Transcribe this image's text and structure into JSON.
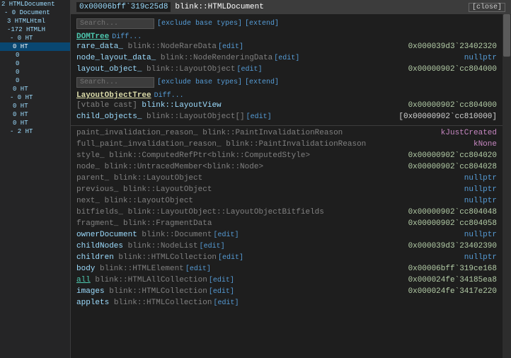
{
  "leftPanel": {
    "items": [
      {
        "label": "2 HTMLDocument",
        "indent": 0,
        "selected": false
      },
      {
        "label": "  - 0 Document",
        "indent": 1,
        "selected": false
      },
      {
        "label": "    3 HTMLHtml",
        "indent": 2,
        "selected": false
      },
      {
        "label": "  -172 HTMLH",
        "indent": 2,
        "selected": false
      },
      {
        "label": "      - 0 HT",
        "indent": 3,
        "selected": false
      },
      {
        "label": "        0 HT",
        "indent": 4,
        "selected": true
      },
      {
        "label": "          0",
        "indent": 5,
        "selected": false
      },
      {
        "label": "          0",
        "indent": 5,
        "selected": false
      },
      {
        "label": "          0",
        "indent": 5,
        "selected": false
      },
      {
        "label": "          0",
        "indent": 5,
        "selected": false
      },
      {
        "label": "        0 HT",
        "indent": 4,
        "selected": false
      },
      {
        "label": "      - 0 HT",
        "indent": 3,
        "selected": false
      },
      {
        "label": "        0 HT",
        "indent": 4,
        "selected": false
      },
      {
        "label": "        0 HT",
        "indent": 4,
        "selected": false
      },
      {
        "label": "        0 HT",
        "indent": 4,
        "selected": false
      },
      {
        "label": "      - 2 HT",
        "indent": 3,
        "selected": false
      }
    ]
  },
  "titleBar": {
    "address": "0x00006bff`319c25d8",
    "className": "blink::HTMLDocument",
    "closeLabel": "[close]"
  },
  "firstSearch": {
    "placeholder": "Search...",
    "excludeLabel": "[exclude base types]",
    "extendLabel": "[extend]"
  },
  "domTreeSection": {
    "headerLabel": "DOMTree",
    "diffLabel": "Diff..."
  },
  "properties1": [
    {
      "name": "rare_data_",
      "type": " blink::NodeRareData",
      "editLabel": "[edit]",
      "value": "0x000039d3`23402320",
      "valueClass": "addr"
    },
    {
      "name": "node_layout_data_",
      "type": " blink::NodeRenderingData",
      "editLabel": "[edit]",
      "value": "nullptr",
      "valueClass": "null"
    },
    {
      "name": "layout_object_",
      "type": " blink::LayoutObject",
      "editLabel": "[edit]",
      "value": "0x00000902`cc804000",
      "valueClass": "addr"
    }
  ],
  "secondSearch": {
    "placeholder": "Search...",
    "excludeLabel": "[exclude base types]",
    "extendLabel": "[extend]"
  },
  "layoutObjectTreeSection": {
    "headerLabel": "LayoutObjectTree",
    "diffLabel": "Diff..."
  },
  "vtable": {
    "castLabel": "[vtable cast]",
    "typeLink": "blink::LayoutView",
    "value": "0x00000902`cc804000",
    "valueClass": "addr"
  },
  "childObjects": {
    "name": "child_objects_",
    "type": " blink::LayoutObject[]",
    "editLabel": "[edit]",
    "value": "[0x00000902`cc810000]",
    "valueClass": "bracket"
  },
  "divider": true,
  "properties2": [
    {
      "name": "paint_invalidation_reason_",
      "type": " blink::PaintInvalidationReason",
      "editLabel": "",
      "value": "kJustCreated",
      "valueClass": "keyword"
    },
    {
      "name": "full_paint_invalidation_reason_",
      "type": " blink::PaintInvalidationReason",
      "editLabel": "",
      "value": "kNone",
      "valueClass": "keyword"
    },
    {
      "name": "style_",
      "type": " blink::ComputedRefPtr<blink::ComputedStyle>",
      "editLabel": "",
      "value": "0x00000902`cc804020",
      "valueClass": "addr"
    },
    {
      "name": "node_",
      "type": " blink::UntracedMember<blink::Node>",
      "editLabel": "",
      "value": "0x00000902`cc804028",
      "valueClass": "addr"
    },
    {
      "name": "parent_",
      "type": " blink::LayoutObject",
      "editLabel": "",
      "value": "nullptr",
      "valueClass": "null"
    },
    {
      "name": "previous_",
      "type": " blink::LayoutObject",
      "editLabel": "",
      "value": "nullptr",
      "valueClass": "null"
    },
    {
      "name": "next_",
      "type": " blink::LayoutObject",
      "editLabel": "",
      "value": "nullptr",
      "valueClass": "null"
    },
    {
      "name": "bitfields_",
      "type": " blink::LayoutObject::LayoutObjectBitfields",
      "editLabel": "",
      "value": "0x00000902`cc804048",
      "valueClass": "addr"
    },
    {
      "name": "fragment_",
      "type": " blink::FragmentData",
      "editLabel": "",
      "value": "0x00000902`cc804058",
      "valueClass": "addr"
    }
  ],
  "properties3": [
    {
      "name": "ownerDocument",
      "type": " blink::Document",
      "editLabel": "[edit]",
      "value": "nullptr",
      "valueClass": "null"
    },
    {
      "name": "childNodes",
      "type": " blink::NodeList",
      "editLabel": "[edit]",
      "value": "0x000039d3`23402390",
      "valueClass": "addr"
    },
    {
      "name": "children",
      "type": " blink::HTMLCollection",
      "editLabel": "[edit]",
      "value": "nullptr",
      "valueClass": "null"
    },
    {
      "name": "body",
      "type": " blink::HTMLElement",
      "editLabel": "[edit]",
      "value": "0x00006bff`319ce168",
      "valueClass": "addr"
    },
    {
      "name": "all",
      "type": " blink::HTMLAllCollection",
      "editLabel": "[edit]",
      "value": "0x000024fe`34185ea8",
      "valueClass": "addr"
    },
    {
      "name": "images",
      "type": " blink::HTMLCollection",
      "editLabel": "[edit]",
      "value": "0x000024fe`3417e220",
      "valueClass": "addr"
    },
    {
      "name": "applets",
      "type": " blink::HTMLCollection",
      "editLabel": "[edit]",
      "value": "",
      "valueClass": "addr"
    }
  ]
}
